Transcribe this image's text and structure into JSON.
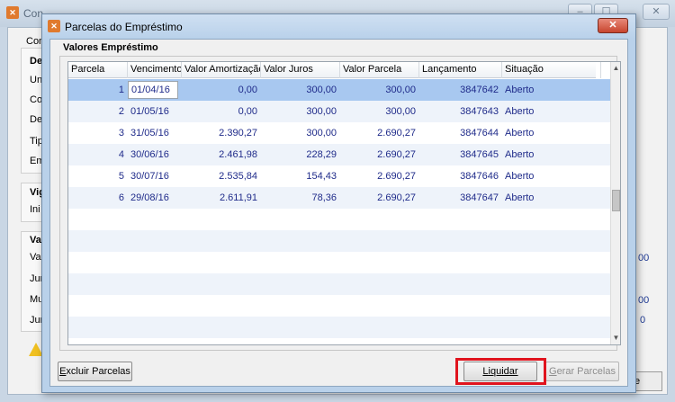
{
  "background_window": {
    "title": "Con",
    "labels": [
      "Con",
      "De",
      "Un",
      "Co",
      "De",
      "Tip",
      "Em",
      "Vig",
      "Ini",
      "Va",
      "Val",
      "Jur",
      "Mu",
      "Jur"
    ],
    "right_values": [
      "00",
      "00",
      "0"
    ],
    "right_button_label": "e",
    "minimize_label": "–",
    "maximize_label": "☐",
    "close_label": "✕"
  },
  "dialog": {
    "title": "Parcelas do Empréstimo",
    "close_label": "✕",
    "group_title": "Valores Empréstimo",
    "grid": {
      "columns": [
        "Parcela",
        "Vencimento",
        "Valor Amortização",
        "Valor Juros",
        "Valor Parcela",
        "Lançamento",
        "Situação"
      ],
      "rows": [
        {
          "parcela": "1",
          "vencimento": "01/04/16",
          "amortizacao": "0,00",
          "juros": "300,00",
          "valor": "300,00",
          "lancamento": "3847642",
          "situacao": "Aberto"
        },
        {
          "parcela": "2",
          "vencimento": "01/05/16",
          "amortizacao": "0,00",
          "juros": "300,00",
          "valor": "300,00",
          "lancamento": "3847643",
          "situacao": "Aberto"
        },
        {
          "parcela": "3",
          "vencimento": "31/05/16",
          "amortizacao": "2.390,27",
          "juros": "300,00",
          "valor": "2.690,27",
          "lancamento": "3847644",
          "situacao": "Aberto"
        },
        {
          "parcela": "4",
          "vencimento": "30/06/16",
          "amortizacao": "2.461,98",
          "juros": "228,29",
          "valor": "2.690,27",
          "lancamento": "3847645",
          "situacao": "Aberto"
        },
        {
          "parcela": "5",
          "vencimento": "30/07/16",
          "amortizacao": "2.535,84",
          "juros": "154,43",
          "valor": "2.690,27",
          "lancamento": "3847646",
          "situacao": "Aberto"
        },
        {
          "parcela": "6",
          "vencimento": "29/08/16",
          "amortizacao": "2.611,91",
          "juros": "78,36",
          "valor": "2.690,27",
          "lancamento": "3847647",
          "situacao": "Aberto"
        }
      ]
    },
    "buttons": {
      "excluir_first": "E",
      "excluir_rest": "xcluir Parcelas",
      "liquidar_first": "L",
      "liquidar_rest": "iquidar",
      "gerar_first": "G",
      "gerar_rest": "erar Parcelas"
    }
  },
  "colors": {
    "selected_row": "#a8c8f0",
    "alt_row": "#eef3fa",
    "cell_text": "#1f2b8a",
    "highlight": "#e0141e"
  }
}
